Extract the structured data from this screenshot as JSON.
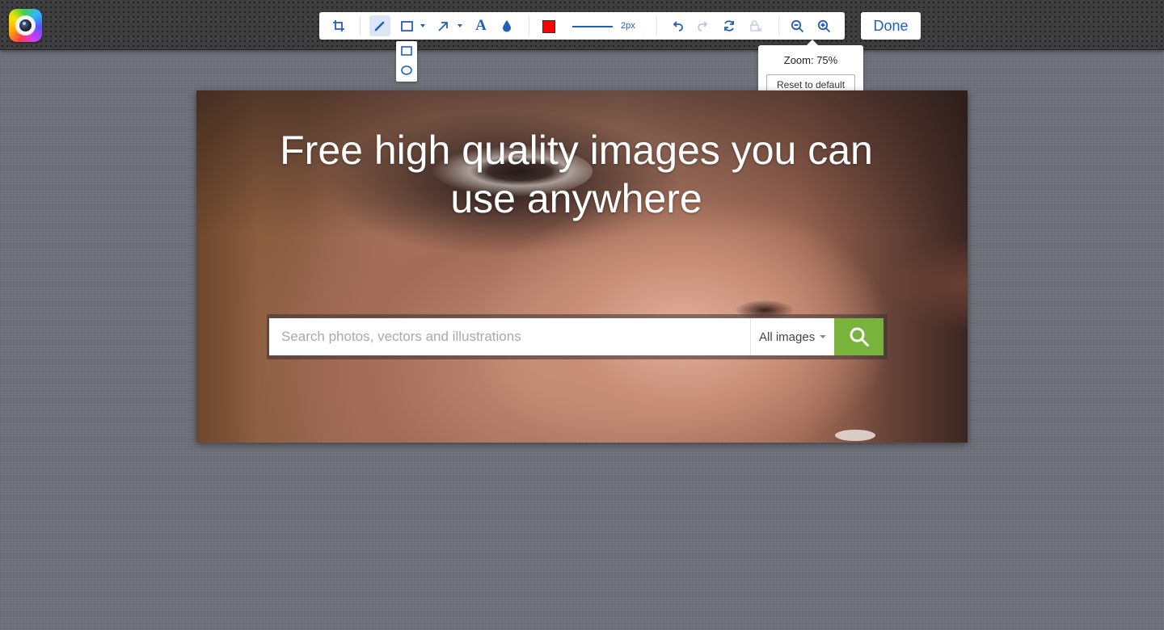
{
  "app": {
    "logo_icon": "camera-lens-icon"
  },
  "toolbar": {
    "tools": [
      {
        "id": "crop",
        "icon": "crop-icon"
      },
      {
        "id": "pencil",
        "icon": "pencil-icon",
        "active": true
      },
      {
        "id": "shape",
        "icon": "rectangle-icon",
        "has_menu": true
      },
      {
        "id": "arrow",
        "icon": "arrow-icon",
        "has_menu": true
      },
      {
        "id": "text",
        "icon": "text-icon",
        "glyph": "A"
      },
      {
        "id": "blur",
        "icon": "drop-icon"
      }
    ],
    "color": "#ff0000",
    "stroke_label": "2px",
    "history": [
      {
        "id": "undo",
        "icon": "undo-icon",
        "enabled": true
      },
      {
        "id": "redo",
        "icon": "redo-icon",
        "enabled": false
      },
      {
        "id": "rotate",
        "icon": "rotate-icon",
        "enabled": true
      },
      {
        "id": "lock",
        "icon": "lock-icon",
        "enabled": false
      }
    ],
    "zoom": [
      {
        "id": "zoom-out",
        "icon": "zoom-out-icon"
      },
      {
        "id": "zoom-in",
        "icon": "zoom-in-icon"
      }
    ],
    "accent": "#1f5fbf"
  },
  "shape_menu": {
    "options": [
      {
        "id": "rectangle",
        "icon": "rectangle-icon"
      },
      {
        "id": "ellipse",
        "icon": "ellipse-icon"
      }
    ]
  },
  "done_label": "Done",
  "zoom_popup": {
    "label": "Zoom: 75%",
    "reset_label": "Reset to default"
  },
  "canvas": {
    "headline": "Free high quality images you can use anywhere",
    "search": {
      "placeholder": "Search photos, vectors and illustrations",
      "type_label": "All images",
      "button_icon": "search-icon",
      "button_color": "#78b33b"
    }
  }
}
